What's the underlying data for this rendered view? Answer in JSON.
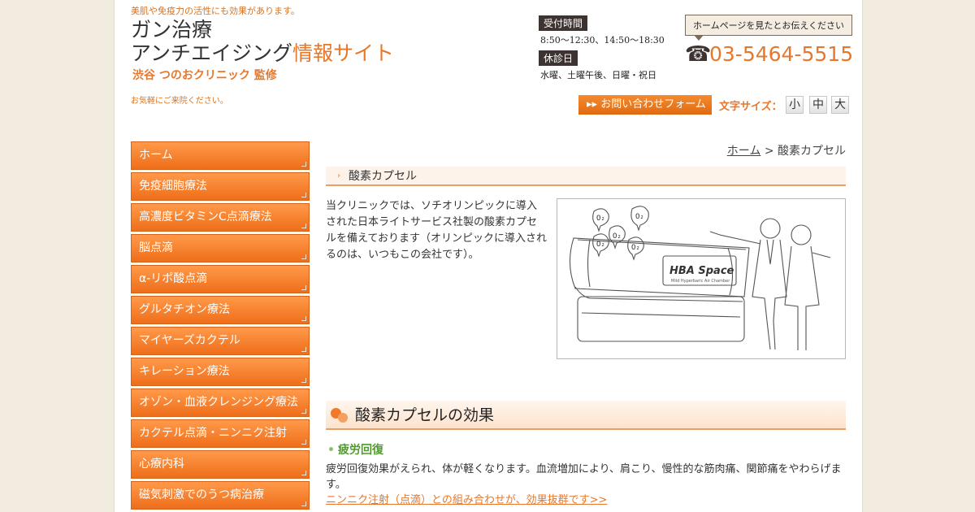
{
  "header": {
    "tagline": "美肌や免疫力の活性にも効果があります。",
    "title_line1": "ガン治療",
    "title_line2": "アンチエイジング",
    "title_line2_hl": "情報サイト",
    "supervisor": "渋谷 つのおクリニック 監修",
    "welcome": "お気軽にご来院ください。"
  },
  "hours": {
    "reception_label": "受付時間",
    "reception_value": "8:50〜12:30、14:50〜18:30",
    "closed_label": "休診日",
    "closed_value": "水曜、土曜午後、日曜・祝日"
  },
  "contact": {
    "note": "ホームページを見たとお伝えください",
    "phone": "03-5464-5515",
    "form_button": "お問い合わせフォーム"
  },
  "font_size": {
    "label": "文字サイズ：",
    "small": "小",
    "medium": "中",
    "large": "大"
  },
  "sidebar": {
    "items": [
      {
        "label": "ホーム"
      },
      {
        "label": "免疫細胞療法"
      },
      {
        "label": "高濃度ビタミンC点滴療法"
      },
      {
        "label": "脳点滴"
      },
      {
        "label": "α-リポ酸点滴"
      },
      {
        "label": "グルタチオン療法"
      },
      {
        "label": "マイヤーズカクテル"
      },
      {
        "label": "キレーション療法"
      },
      {
        "label": "オゾン・血液クレンジング療法"
      },
      {
        "label": "カクテル点滴・ニンニク注射"
      },
      {
        "label": "心療内科"
      },
      {
        "label": "磁気刺激でのうつ病治療"
      }
    ]
  },
  "breadcrumb": {
    "home": "ホーム",
    "sep": ">",
    "current": "酸素カプセル"
  },
  "main": {
    "section_title": "酸素カプセル",
    "intro": "当クリニックでは、ソチオリンピックに導入された日本ライトサービス社製の酸素カプセルを備えております（オリンピックに導入されるのは、いつもこの会社です）。",
    "illustration_text": "HBA Space",
    "illustration_subtext": "Mild Hyperbaric Air Chamber",
    "h2": "酸素カプセルの効果",
    "sub_heading": "疲労回復",
    "body": "疲労回復効果がえられ、体が軽くなります。血流増加により、肩こり、慢性的な筋肉痛、関節痛をやわらげます。",
    "link": "ニンニク注射（点滴）との組み合わせが、効果抜群です>>"
  },
  "colors": {
    "accent": "#e8772a",
    "nav_top": "#ff9a4a",
    "nav_bottom": "#ee6e1a",
    "green": "#4f9b2e",
    "background": "#f1ecdf"
  }
}
